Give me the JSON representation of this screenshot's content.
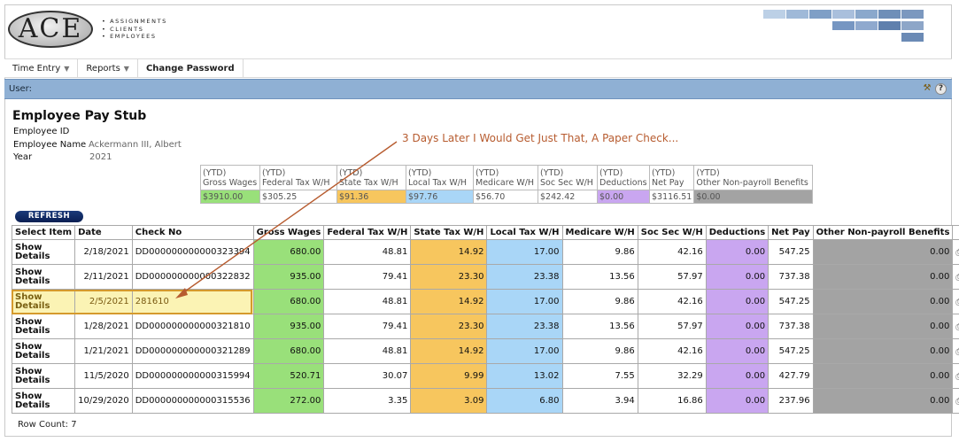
{
  "logo": {
    "text": "ACE",
    "tagline": [
      "• ASSIGNMENTS",
      "• CLIENTS",
      "• EMPLOYEES"
    ]
  },
  "nav": {
    "time_entry": "Time Entry",
    "reports": "Reports",
    "change_password": "Change Password"
  },
  "userbar": {
    "label": "User:"
  },
  "page": {
    "title": "Employee Pay Stub"
  },
  "employee": {
    "id_label": "Employee ID",
    "id_value": "",
    "name_label": "Employee Name",
    "name_value": "Ackermann III, Albert",
    "year_label": "Year",
    "year_value": "2021"
  },
  "annotation": "3 Days Later I Would Get Just That, A Paper Check...",
  "ytd": {
    "headers": [
      "(YTD)\nGross Wages",
      "(YTD)\nFederal Tax W/H",
      "(YTD)\nState Tax W/H",
      "(YTD)\nLocal Tax W/H",
      "(YTD)\nMedicare W/H",
      "(YTD)\nSoc Sec W/H",
      "(YTD)\nDeductions",
      "(YTD)\nNet Pay",
      "(YTD)\nOther Non-payroll Benefits"
    ],
    "values": [
      "$3910.00",
      "$305.25",
      "$91.36",
      "$97.76",
      "$56.70",
      "$242.42",
      "$0.00",
      "$3116.51",
      "$0.00"
    ]
  },
  "refresh_label": "REFRESH",
  "table": {
    "headers": [
      "Select Item",
      "Date",
      "Check No",
      "Gross Wages",
      "Federal Tax W/H",
      "State Tax W/H",
      "Local Tax W/H",
      "Medicare W/H",
      "Soc Sec W/H",
      "Deductions",
      "Net Pay",
      "Other Non-payroll Benefits",
      ""
    ],
    "rows": [
      {
        "select": "Show Details",
        "date": "2/18/2021",
        "check": "DD000000000000323394",
        "gross": "680.00",
        "fed": "48.81",
        "state": "14.92",
        "local": "17.00",
        "medicare": "9.86",
        "ss": "42.16",
        "ded": "0.00",
        "net": "547.25",
        "other": "0.00"
      },
      {
        "select": "Show Details",
        "date": "2/11/2021",
        "check": "DD000000000000322832",
        "gross": "935.00",
        "fed": "79.41",
        "state": "23.30",
        "local": "23.38",
        "medicare": "13.56",
        "ss": "57.97",
        "ded": "0.00",
        "net": "737.38",
        "other": "0.00"
      },
      {
        "select": "Show Details",
        "date": "2/5/2021",
        "check": "281610",
        "gross": "680.00",
        "fed": "48.81",
        "state": "14.92",
        "local": "17.00",
        "medicare": "9.86",
        "ss": "42.16",
        "ded": "0.00",
        "net": "547.25",
        "other": "0.00"
      },
      {
        "select": "Show Details",
        "date": "1/28/2021",
        "check": "DD000000000000321810",
        "gross": "935.00",
        "fed": "79.41",
        "state": "23.30",
        "local": "23.38",
        "medicare": "13.56",
        "ss": "57.97",
        "ded": "0.00",
        "net": "737.38",
        "other": "0.00"
      },
      {
        "select": "Show Details",
        "date": "1/21/2021",
        "check": "DD000000000000321289",
        "gross": "680.00",
        "fed": "48.81",
        "state": "14.92",
        "local": "17.00",
        "medicare": "9.86",
        "ss": "42.16",
        "ded": "0.00",
        "net": "547.25",
        "other": "0.00"
      },
      {
        "select": "Show Details",
        "date": "11/5/2020",
        "check": "DD000000000000315994",
        "gross": "520.71",
        "fed": "30.07",
        "state": "9.99",
        "local": "13.02",
        "medicare": "7.55",
        "ss": "32.29",
        "ded": "0.00",
        "net": "427.79",
        "other": "0.00"
      },
      {
        "select": "Show Details",
        "date": "10/29/2020",
        "check": "DD000000000000315536",
        "gross": "272.00",
        "fed": "3.35",
        "state": "3.09",
        "local": "6.80",
        "medicare": "3.94",
        "ss": "16.86",
        "ded": "0.00",
        "net": "237.96",
        "other": "0.00"
      }
    ],
    "row_count": "Row Count: 7"
  },
  "colors": {
    "gross": "#99e07a",
    "state": "#f7c65e",
    "local": "#a9d6f7",
    "deductions": "#c9a6f0",
    "other": "#a3a3a3",
    "userbar": "#8fb0d4",
    "highlight_border": "#d59a2d",
    "annotation": "#b75c30"
  },
  "icons": {
    "print": "print-icon",
    "tools": "tools-icon",
    "help": "help-icon"
  }
}
